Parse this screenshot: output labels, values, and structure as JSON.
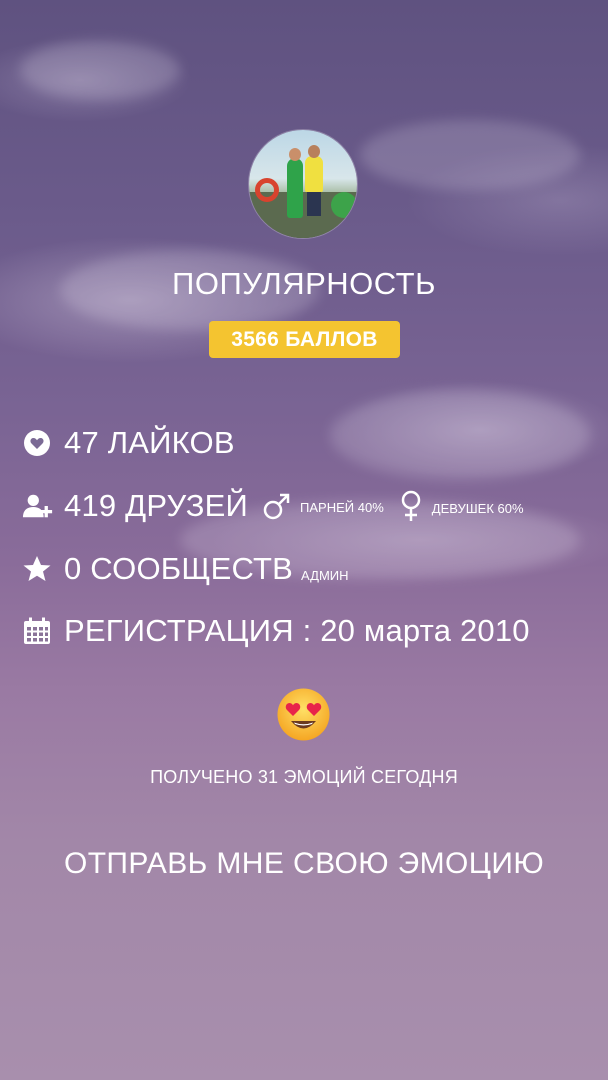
{
  "profile": {
    "popularity_label": "ПОПУЛЯРНОСТЬ",
    "score_badge": "3566 БАЛЛОВ"
  },
  "stats": {
    "likes": {
      "icon": "heart-icon",
      "text": "47 ЛАЙКОВ"
    },
    "friends": {
      "icon": "add-user-icon",
      "text": "419 ДРУЗЕЙ",
      "male_icon": "male-icon",
      "male_text": "ПАРНЕЙ 40%",
      "female_icon": "female-icon",
      "female_text": "ДЕВУШЕК 60%"
    },
    "communities": {
      "icon": "star-icon",
      "text": "0 СООБЩЕСТВ",
      "admin": "АДМИН"
    },
    "registration": {
      "icon": "calendar-icon",
      "text": "РЕГИСТРАЦИЯ : 20 марта 2010"
    }
  },
  "emotions": {
    "emoji": "heart-eyes-emoji",
    "received": "ПОЛУЧЕНО 31 ЭМОЦИЙ СЕГОДНЯ",
    "send_cta": "ОТПРАВЬ МНЕ СВОЮ ЭМОЦИЮ"
  },
  "colors": {
    "badge": "#f4c430",
    "text": "#ffffff",
    "background_top": "#5f5280",
    "background_bottom": "#a88fad"
  }
}
